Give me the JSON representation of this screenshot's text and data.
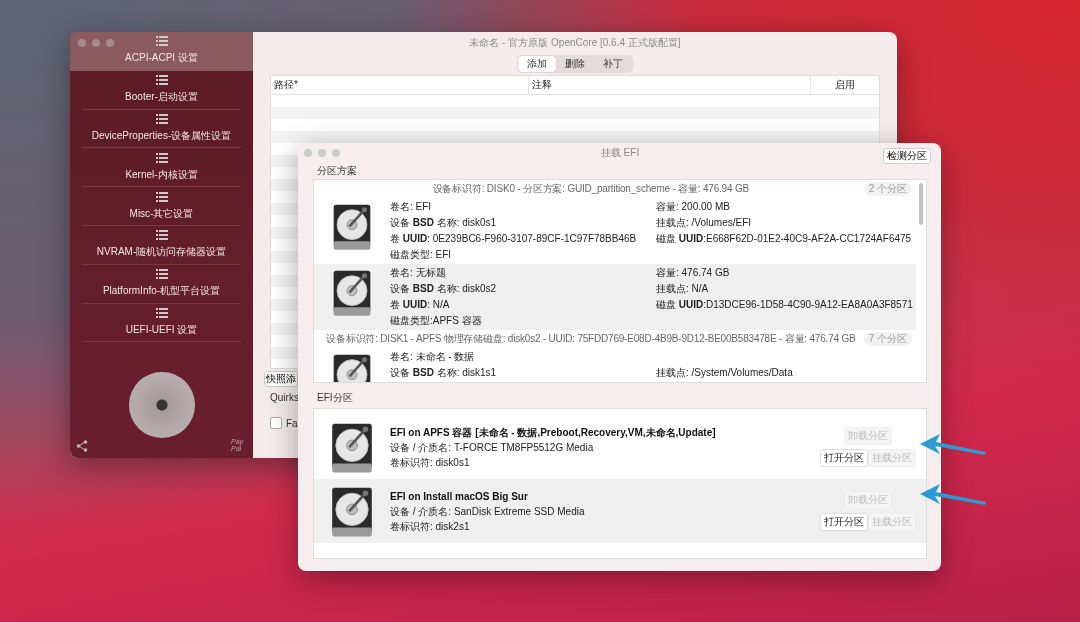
{
  "main_window": {
    "title": "未命名 - 官方原版 OpenCore [0.6.4 正式版配置]",
    "sidebar": {
      "items": [
        {
          "label": "ACPI-ACPI 设置",
          "selected": true
        },
        {
          "label": "Booter-启动设置",
          "selected": false
        },
        {
          "label": "DeviceProperties-设备属性设置",
          "selected": false
        },
        {
          "label": "Kernel-内核设置",
          "selected": false
        },
        {
          "label": "Misc-其它设置",
          "selected": false
        },
        {
          "label": "NVRAM-随机访问存储器设置",
          "selected": false
        },
        {
          "label": "PlatformInfo-机型平台设置",
          "selected": false
        },
        {
          "label": "UEFI-UEFI 设置",
          "selected": false
        }
      ],
      "paypal": "Pay Pal"
    },
    "segments": [
      {
        "label": "添加",
        "selected": true
      },
      {
        "label": "删除",
        "selected": false
      },
      {
        "label": "补丁",
        "selected": false
      }
    ],
    "table": {
      "columns": [
        "路径*",
        "注释",
        "启用"
      ]
    },
    "snapshot_button": "快照添",
    "quirks_label": "Quirks",
    "checkbox": {
      "label": "Fa",
      "checked": false
    }
  },
  "dialog": {
    "title": "挂载 EFI",
    "detect_button": "检测分区",
    "partition_section": {
      "label": "分区方案",
      "groups": [
        {
          "header": "设备标识符: DISK0 - 分区方案: GUID_partition_scheme - 容量: 476.94 GB",
          "badge": "2 个分区",
          "partitions": [
            {
              "lines": [
                {
                  "left": "卷名: EFI",
                  "right": "容量:  200.00 MB"
                },
                {
                  "left": "设备 **BSD** 名称: disk0s1",
                  "right": "挂载点: /Volumes/EFI"
                },
                {
                  "left": "卷 **UUID**: 0E239BC6-F960-3107-89CF-1C97F78BB46B",
                  "right": "磁盘 **UUID**:E668F62D-01E2-40C9-AF2A-CC1724AF6475"
                },
                {
                  "left": "磁盘类型: EFI"
                }
              ]
            },
            {
              "lines": [
                {
                  "left": "卷名: 无标题",
                  "right": "容量:  476.74 GB"
                },
                {
                  "left": "设备 **BSD** 名称: disk0s2",
                  "right": "挂载点: N/A"
                },
                {
                  "left": "卷 **UUID**: N/A",
                  "right": "磁盘 **UUID**:D13DCE96-1D58-4C90-9A12-EA8A0A3F8571"
                },
                {
                  "left": "磁盘类型:APFS 容器"
                }
              ]
            }
          ]
        },
        {
          "header": "设备标识符: DISK1 - APFS 物理存储磁盘: disk0s2 - UUID: 75FDD769-E08D-4B9B-9D12-BE00B583478E - 容量: 476.74 GB",
          "badge": "7 个分区",
          "partitions": [
            {
              "lines": [
                {
                  "left": "卷名: 未命名 - 数据"
                },
                {
                  "left": "设备 **BSD** 名称: disk1s1",
                  "right": "挂载点: /System/Volumes/Data"
                }
              ]
            }
          ]
        }
      ]
    },
    "efi_section": {
      "label": "EFI分区",
      "entries": [
        {
          "title": "EFI on APFS 容器 [未命名 - 数据,Preboot,Recovery,VM,未命名,Update]",
          "lines": [
            "设备 / 介质名: T-FORCE TM8FP5512G Media",
            "卷标识符: disk0s1"
          ],
          "unmount": {
            "label": "卸载分区",
            "disabled": true
          },
          "open": {
            "label": "打开分区",
            "disabled": false
          },
          "mount": {
            "label": "挂载分区",
            "disabled": true
          }
        },
        {
          "title": "EFI on Install macOS Big Sur",
          "lines": [
            "设备 / 介质名: SanDisk Extreme SSD Media",
            "卷标识符: disk2s1"
          ],
          "unmount": {
            "label": "卸载分区",
            "disabled": true
          },
          "open": {
            "label": "打开分区",
            "disabled": false
          },
          "mount": {
            "label": "挂载分区",
            "disabled": true
          }
        }
      ]
    }
  }
}
